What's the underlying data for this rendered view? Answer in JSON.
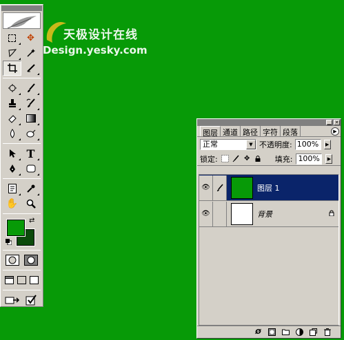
{
  "watermark": {
    "cn": "天极设计在线",
    "en": "Design.yesky.com"
  },
  "colors": {
    "foreground": "#079a07",
    "background": "#0b4a0b",
    "canvas": "#079a07",
    "selection": "#0a246a"
  },
  "toolbox": {
    "tools": [
      [
        "marquee-icon",
        "move-icon"
      ],
      [
        "lasso-icon",
        "magic-wand-icon"
      ],
      [
        "crop-icon",
        "slice-icon"
      ],
      [
        "healing-brush-icon",
        "brush-icon"
      ],
      [
        "clone-stamp-icon",
        "history-brush-icon"
      ],
      [
        "eraser-icon",
        "gradient-icon"
      ],
      [
        "blur-icon",
        "dodge-icon"
      ],
      [
        "path-select-icon",
        "type-icon"
      ],
      [
        "pen-icon",
        "shape-icon"
      ],
      [
        "notes-icon",
        "eyedropper-icon"
      ],
      [
        "hand-icon",
        "zoom-icon"
      ]
    ],
    "type_tool_glyph": "T"
  },
  "layers_panel": {
    "tabs": [
      "图层",
      "通道",
      "路径",
      "字符",
      "段落"
    ],
    "blend_mode": "正常",
    "opacity_label": "不透明度:",
    "opacity_value": "100%",
    "lock_label": "锁定:",
    "fill_label": "填充:",
    "fill_value": "100%",
    "layers": [
      {
        "name": "图层 1",
        "selected": true,
        "thumb_color": "#079a07",
        "locked": false
      },
      {
        "name": "背景",
        "selected": false,
        "thumb_color": "#ffffff",
        "locked": true
      }
    ]
  }
}
